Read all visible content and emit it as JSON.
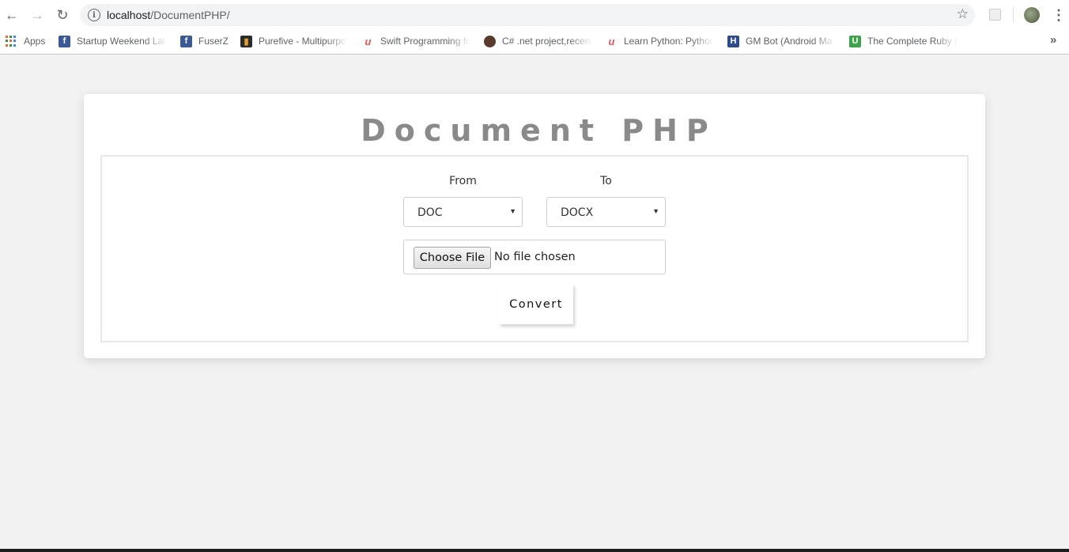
{
  "browser": {
    "url_host": "localhost",
    "url_path": "/DocumentPHP/",
    "info_icon": "info-icon",
    "bookmarks": [
      {
        "label": "Apps",
        "icon": "apps-grid-icon"
      },
      {
        "label": "Startup Weekend Lah",
        "icon": "facebook-icon",
        "color": "#3b5998"
      },
      {
        "label": "FuserZ",
        "icon": "facebook-icon",
        "color": "#3b5998"
      },
      {
        "label": "Purefive - Multipurpc",
        "icon": "purefive-icon",
        "color": "#2b2b2b"
      },
      {
        "label": "Swift Programming fc",
        "icon": "udemy-icon",
        "color": "#ec5252"
      },
      {
        "label": "C# .net project,recent",
        "icon": "csharp-icon",
        "color": "#5a3a2a"
      },
      {
        "label": "Learn Python: Pythor",
        "icon": "udemy-icon",
        "color": "#ec5252"
      },
      {
        "label": "GM Bot (Android Ma",
        "icon": "hackread-icon",
        "color": "#2c4a8c"
      },
      {
        "label": "The Complete Ruby D",
        "icon": "upwork-icon",
        "color": "#3fa34d"
      }
    ],
    "more_label": "»"
  },
  "page": {
    "title": "Document PHP",
    "from": {
      "label": "From",
      "selected": "DOC"
    },
    "to": {
      "label": "To",
      "selected": "DOCX"
    },
    "file": {
      "button_label": "Choose File",
      "status": "No file chosen"
    },
    "convert_label": "Convert"
  },
  "colors": {
    "page_bg": "#f2f2f2",
    "title": "#8a8a8a",
    "card_bg": "#ffffff"
  }
}
